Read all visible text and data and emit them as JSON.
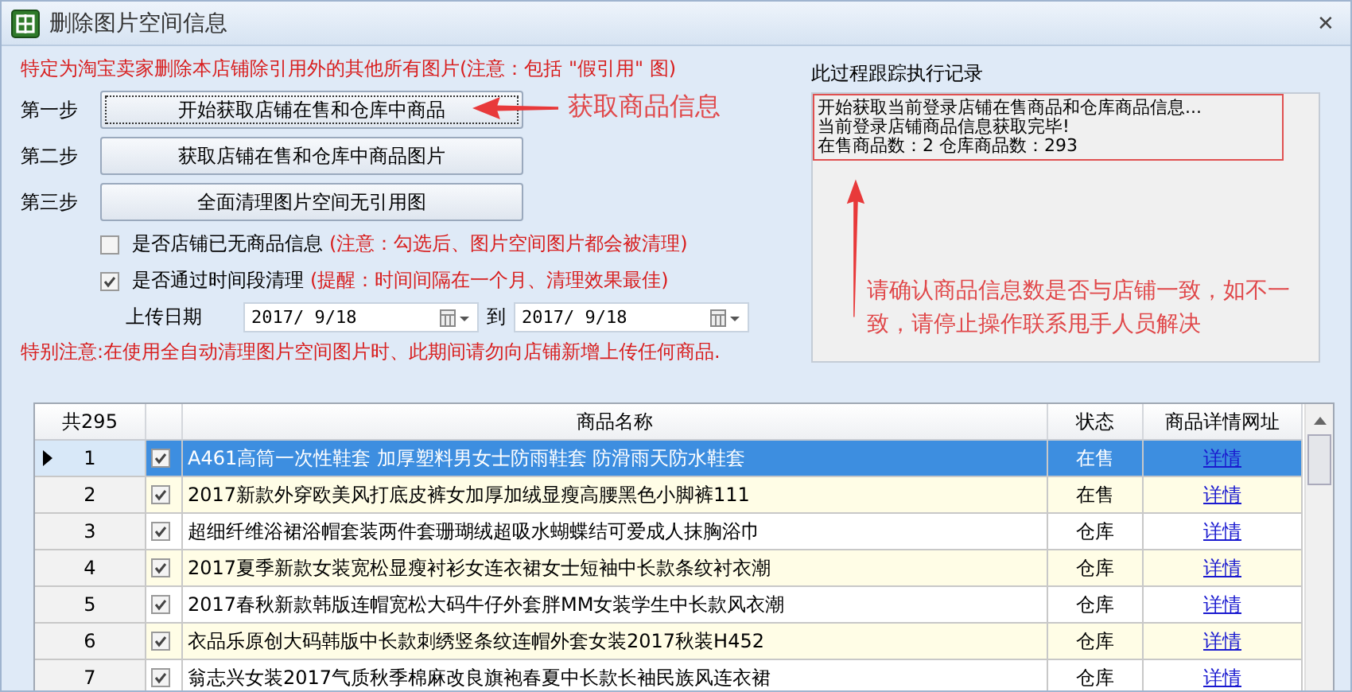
{
  "window": {
    "title": "删除图片空间信息",
    "close": "✕"
  },
  "notice": "特定为淘宝卖家删除本店铺除引用外的其他所有图片(注意：包括 \"假引用\" 图)",
  "steps": [
    {
      "label": "第一步",
      "button": "开始获取店铺在售和仓库中商品",
      "focused": true
    },
    {
      "label": "第二步",
      "button": "获取店铺在售和仓库中商品图片",
      "focused": false
    },
    {
      "label": "第三步",
      "button": "全面清理图片空间无引用图",
      "focused": false
    }
  ],
  "options": [
    {
      "label": "是否店铺已无商品信息",
      "note": "(注意：勾选后、图片空间图片都会被清理)",
      "checked": false
    },
    {
      "label": "是否通过时间段清理",
      "note": "(提醒：时间间隔在一个月、清理效果最佳)",
      "checked": true
    }
  ],
  "date": {
    "label": "上传日期",
    "from": "2017/ 9/18",
    "to_label": "到",
    "to": "2017/ 9/18"
  },
  "warning": "特别注意:在使用全自动清理图片空间图片时、此期间请勿向店铺新增上传任何商品.",
  "log": {
    "title": "此过程跟踪执行记录",
    "lines": [
      "开始获取当前登录店铺在售商品和仓库商品信息...",
      "当前登录店铺商品信息获取完毕!",
      "在售商品数：2  仓库商品数：293"
    ]
  },
  "annotations": [
    {
      "text": "获取商品信息"
    },
    {
      "text": "请确认商品信息数是否与店铺一致，如不一致，请停止操作联系甩手人员解决"
    }
  ],
  "table": {
    "count": "共295",
    "columns": [
      "商品名称",
      "状态",
      "商品详情网址"
    ],
    "rows": [
      {
        "index": "1",
        "checked": true,
        "name": "A461高筒一次性鞋套 加厚塑料男女士防雨鞋套 防滑雨天防水鞋套",
        "status": "在售",
        "link": "详情",
        "selected": true
      },
      {
        "index": "2",
        "checked": true,
        "name": "2017新款外穿欧美风打底皮裤女加厚加绒显瘦高腰黑色小脚裤111",
        "status": "在售",
        "link": "详情",
        "selected": false
      },
      {
        "index": "3",
        "checked": true,
        "name": "超细纤维浴裙浴帽套装两件套珊瑚绒超吸水蝴蝶结可爱成人抹胸浴巾",
        "status": "仓库",
        "link": "详情",
        "selected": false
      },
      {
        "index": "4",
        "checked": true,
        "name": "2017夏季新款女装宽松显瘦衬衫女连衣裙女士短袖中长款条纹衬衣潮",
        "status": "仓库",
        "link": "详情",
        "selected": false
      },
      {
        "index": "5",
        "checked": true,
        "name": "2017春秋新款韩版连帽宽松大码牛仔外套胖MM女装学生中长款风衣潮",
        "status": "仓库",
        "link": "详情",
        "selected": false
      },
      {
        "index": "6",
        "checked": true,
        "name": "衣品乐原创大码韩版中长款刺绣竖条纹连帽外套女装2017秋装H452",
        "status": "仓库",
        "link": "详情",
        "selected": false
      },
      {
        "index": "7",
        "checked": true,
        "name": "翁志兴女装2017气质秋季棉麻改良旗袍春夏中长款长袖民族风连衣裙",
        "status": "仓库",
        "link": "详情",
        "selected": false
      }
    ]
  }
}
